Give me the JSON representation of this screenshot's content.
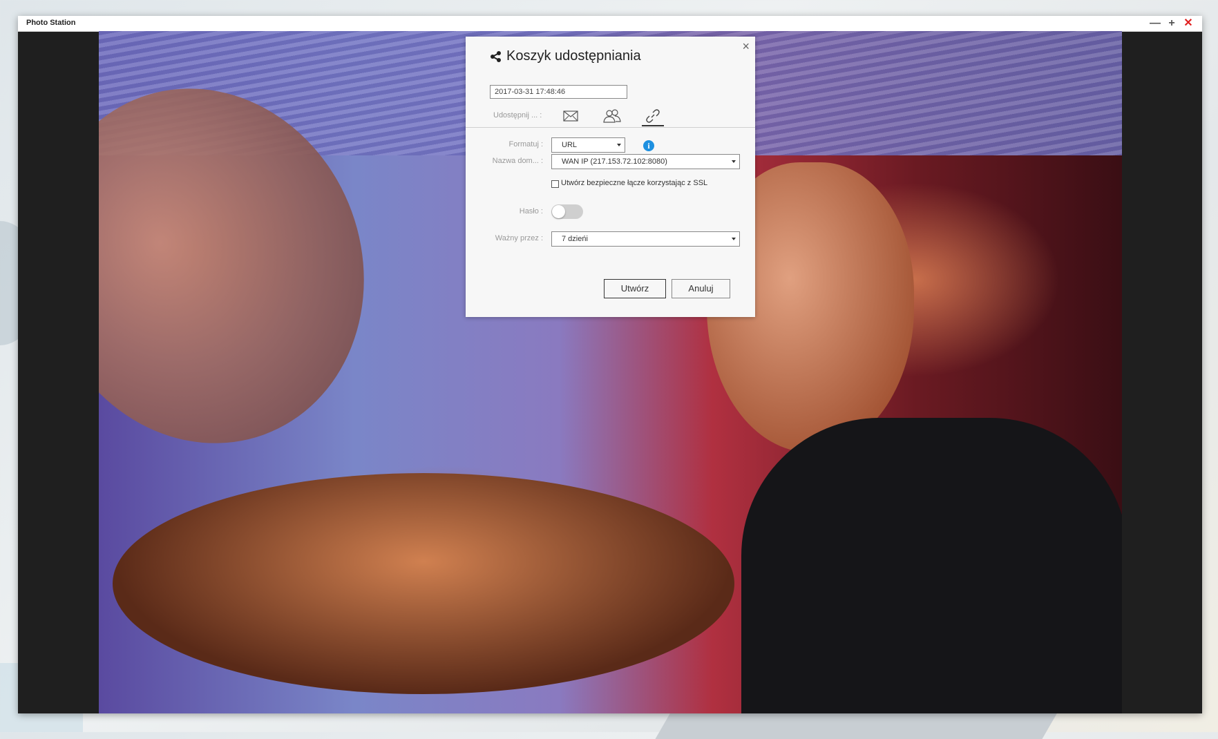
{
  "window": {
    "title": "Photo Station",
    "controls": [
      "minimize-icon",
      "maximize-icon",
      "close-icon"
    ]
  },
  "dialog": {
    "title": "Koszyk udostępniania",
    "title_icon": "share-icon",
    "close_label": "×",
    "name_value": "2017-03-31 17:48:46",
    "share_label": "Udostępnij ... :",
    "tabs": [
      {
        "icon": "email-icon",
        "active": false
      },
      {
        "icon": "users-icon",
        "active": false
      },
      {
        "icon": "link-icon",
        "active": true
      }
    ],
    "format_label": "Formatuj :",
    "format_value": "URL",
    "info_label": "i",
    "domain_label": "Nazwa dom... :",
    "domain_value": "WAN IP (217.153.72.102:8080)",
    "ssl_label": "Utwórz bezpieczne łącze korzystając z SSL",
    "ssl_checked": false,
    "password_label": "Hasło :",
    "password_enabled": false,
    "valid_label": "Ważny przez :",
    "valid_value": "7 dzieńi",
    "create_label": "Utwórz",
    "cancel_label": "Anuluj"
  },
  "colors": {
    "info": "#1e90e0",
    "close": "#e02020"
  }
}
